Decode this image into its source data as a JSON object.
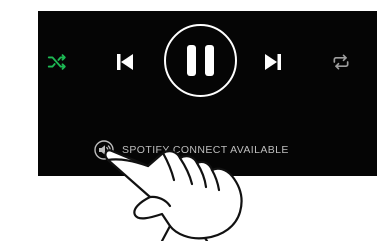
{
  "player": {
    "controls": [
      {
        "id": "shuffle",
        "icon": "shuffle-icon",
        "color": "#1db954"
      },
      {
        "id": "previous",
        "icon": "skip-previous-icon",
        "color": "#ffffff"
      },
      {
        "id": "play_pause",
        "icon": "pause-icon",
        "state": "playing",
        "color": "#ffffff"
      },
      {
        "id": "next",
        "icon": "skip-next-icon",
        "color": "#ffffff"
      },
      {
        "id": "repeat",
        "icon": "repeat-icon",
        "color": "#9e9e9e"
      }
    ],
    "background": "#050505"
  },
  "connect": {
    "icon": "speaker-icon",
    "label": "SPOTIFY CONNECT AVAILABLE",
    "label_color": "#bdbdbd"
  },
  "overlay": {
    "icon": "pointing-hand-icon"
  }
}
